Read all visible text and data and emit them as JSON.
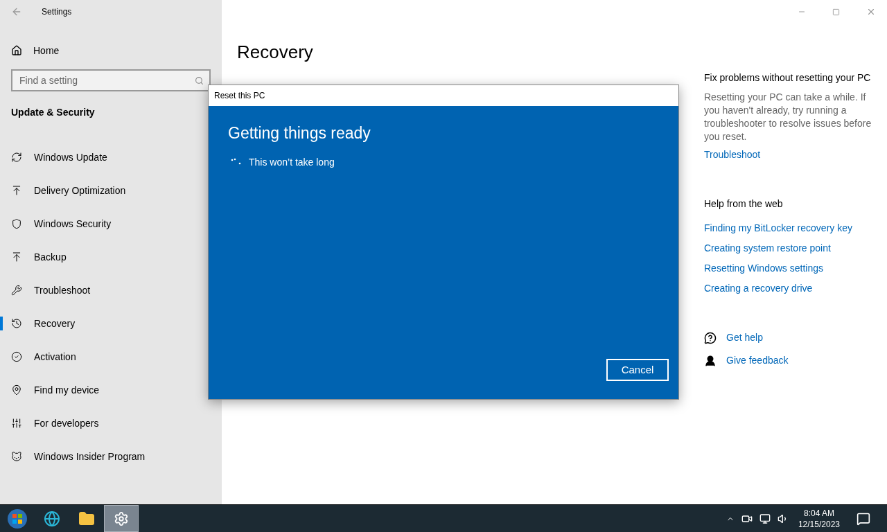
{
  "window": {
    "title": "Settings"
  },
  "sidebar": {
    "home": "Home",
    "search": {
      "placeholder": "Find a setting"
    },
    "section": "Update & Security",
    "items": [
      {
        "label": "Windows Update",
        "selected": false
      },
      {
        "label": "Delivery Optimization",
        "selected": false
      },
      {
        "label": "Windows Security",
        "selected": false
      },
      {
        "label": "Backup",
        "selected": false
      },
      {
        "label": "Troubleshoot",
        "selected": false
      },
      {
        "label": "Recovery",
        "selected": true
      },
      {
        "label": "Activation",
        "selected": false
      },
      {
        "label": "Find my device",
        "selected": false
      },
      {
        "label": "For developers",
        "selected": false
      },
      {
        "label": "Windows Insider Program",
        "selected": false
      }
    ]
  },
  "main": {
    "title": "Recovery"
  },
  "related": {
    "fix_title": "Fix problems without resetting your PC",
    "fix_text": "Resetting your PC can take a while. If you haven't already, try running a troubleshooter to resolve issues before you reset.",
    "fix_link": "Troubleshoot",
    "web_title": "Help from the web",
    "web_links": [
      "Finding my BitLocker recovery key",
      "Creating system restore point",
      "Resetting Windows settings",
      "Creating a recovery drive"
    ],
    "support": [
      {
        "kind": "help",
        "label": "Get help"
      },
      {
        "kind": "feedback",
        "label": "Give feedback"
      }
    ]
  },
  "dialog": {
    "title": "Reset this PC",
    "heading": "Getting things ready",
    "message": "This won’t take long",
    "button": "Cancel"
  },
  "taskbar": {
    "apps": [
      {
        "kind": "start",
        "selected": false
      },
      {
        "kind": "browser",
        "selected": false
      },
      {
        "kind": "folder",
        "selected": false
      },
      {
        "kind": "settings",
        "selected": true
      }
    ],
    "time": "8:04 AM",
    "date": "12/15/2023"
  }
}
